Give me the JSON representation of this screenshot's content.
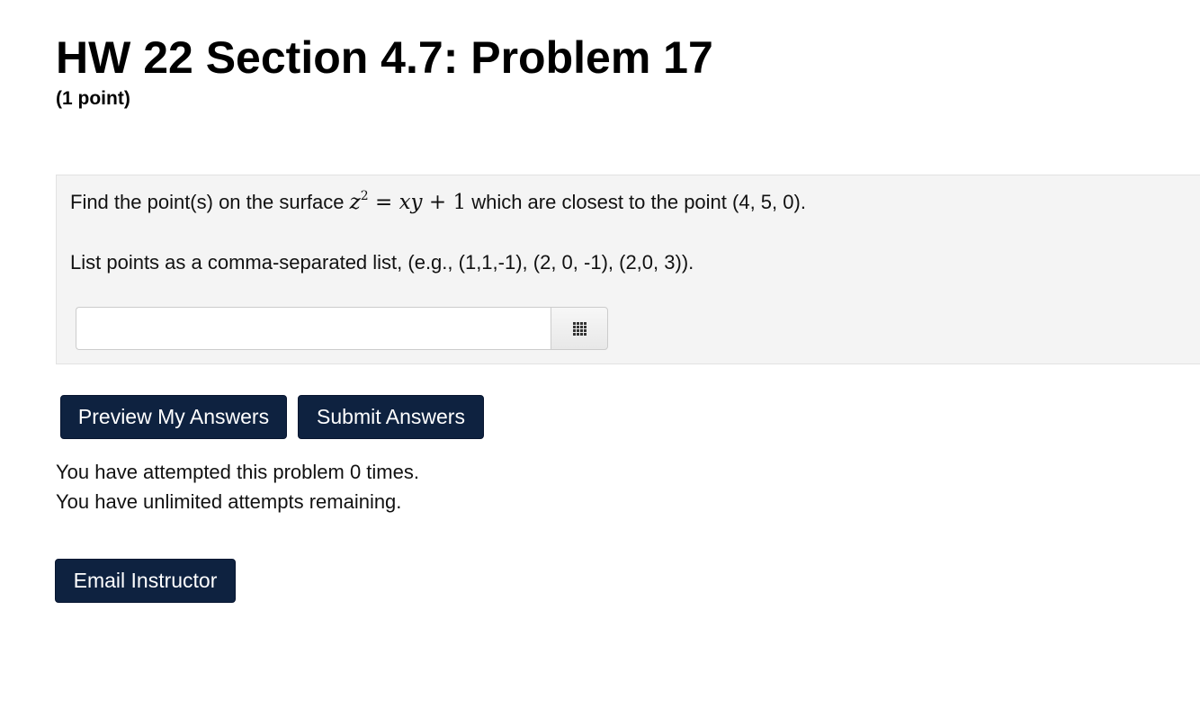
{
  "header": {
    "title": "HW 22 Section 4.7: Problem 17",
    "points": "(1 point)"
  },
  "problem": {
    "text_before": "Find the point(s) on the surface ",
    "text_after": " which are closest to the point (4, 5, 0).",
    "instructions": "List points as a comma-separated list, (e.g., (1,1,-1), (2, 0, -1), (2,0, 3)).",
    "answer_value": "",
    "palette_icon": "grid-icon"
  },
  "buttons": {
    "preview_label": "Preview My Answers",
    "submit_label": "Submit Answers",
    "email_label": "Email Instructor"
  },
  "status": {
    "attempts": "You have attempted this problem 0 times.",
    "remaining": "You have unlimited attempts remaining."
  },
  "colors": {
    "button_bg": "#0e2240",
    "problem_bg": "#f4f4f4"
  }
}
